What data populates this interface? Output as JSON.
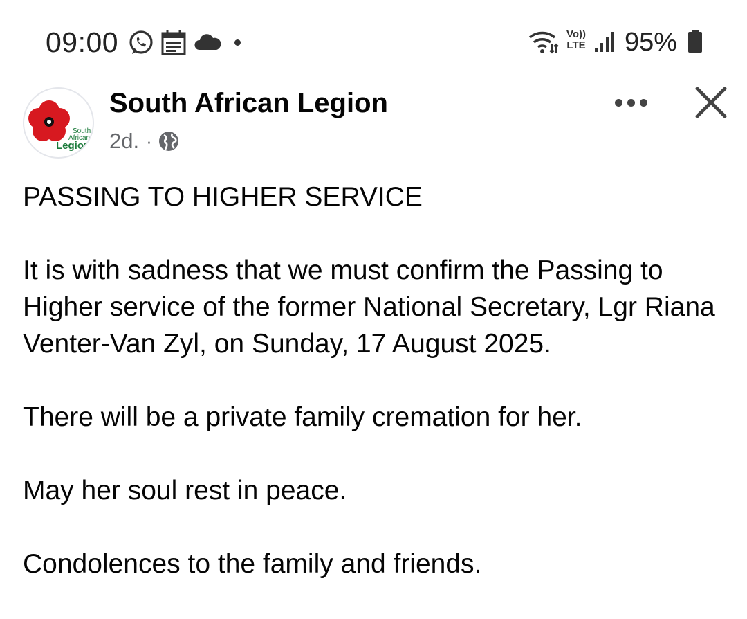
{
  "status_bar": {
    "time": "09:00",
    "left_icons": [
      "whatsapp-icon",
      "calendar-icon",
      "cloud-icon",
      "notification-dot"
    ],
    "right_icons": [
      "wifi-icon",
      "volte-icon",
      "signal-icon",
      "battery-icon"
    ],
    "volte_label_top": "Vo))",
    "volte_label_bottom": "LTE",
    "battery_percent": "95%"
  },
  "post": {
    "page_name": "South African Legion",
    "avatar_text_line1": "South",
    "avatar_text_line2": "African",
    "avatar_text_line3": "Legion",
    "timestamp": "2d.",
    "separator": "·",
    "audience_icon": "globe-icon",
    "menu_icon": "more-icon",
    "close_icon": "close-icon",
    "paragraphs": [
      "PASSING TO HIGHER SERVICE",
      "It is with sadness that we must confirm the Passing to Higher service of the former National Secretary, Lgr Riana Venter-Van Zyl, on Sunday, 17 August 2025.",
      "There will be a private family cremation for her.",
      "May her soul rest in peace.",
      "Condolences to the family and friends."
    ]
  },
  "colors": {
    "text_primary": "#050505",
    "text_secondary": "#65676b",
    "poppy_red": "#d71920",
    "legion_green": "#1a7a3a"
  }
}
